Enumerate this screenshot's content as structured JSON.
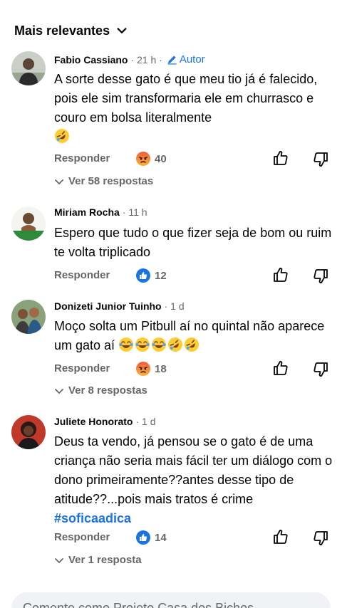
{
  "sort": {
    "label": "Mais relevantes",
    "icon": "chevron-down-icon"
  },
  "comments": [
    {
      "name": "Fabio Cassiano",
      "time": "· 21 h ·",
      "badge": "Autor",
      "text": "A sorte desse gato é que meu tio já é falecido, pois ele sim transformaria ele em churrasco e couro em bolsa literalmente",
      "emojis": [
        "rolling-laughing-emoji"
      ],
      "reply_label": "Responder",
      "reaction": "angry",
      "reaction_count": "40",
      "replies_label": "Ver 58 respostas"
    },
    {
      "name": "Miriam Rocha",
      "time": "· 11 h",
      "text": "Espero que tudo o que fizer seja de bom ou ruim te volta triplicado",
      "reply_label": "Responder",
      "reaction": "like",
      "reaction_count": "12"
    },
    {
      "name": "Donizeti Junior Tuinho",
      "time": "· 1 d",
      "text": "Moço solta um Pitbull aí no quintal não aparece um gato aí",
      "emojis": [
        "tears-of-joy-emoji",
        "tears-of-joy-emoji",
        "tears-of-joy-emoji",
        "rolling-laughing-emoji",
        "rolling-laughing-emoji"
      ],
      "reply_label": "Responder",
      "reaction": "angry",
      "reaction_count": "18",
      "replies_label": "Ver 8 respostas"
    },
    {
      "name": "Juliete Honorato",
      "time": "· 1 d",
      "text": "Deus ta vendo, já pensou se o gato é de uma criança não seria mais fácil ter um diálogo com o dono primeiramente??antes desse tipo de atitude??...pois mais tratos é crime",
      "hashtag": "#soficaadica",
      "reply_label": "Responder",
      "reaction": "like",
      "reaction_count": "14",
      "replies_label": "Ver 1 resposta"
    }
  ],
  "composer": {
    "placeholder": "Comente como Projeto Casa dos Bichos"
  },
  "colors": {
    "accent": "#1b74e4",
    "muted": "#65676b",
    "angry": "#f26d32",
    "like": "#1b74e4"
  }
}
